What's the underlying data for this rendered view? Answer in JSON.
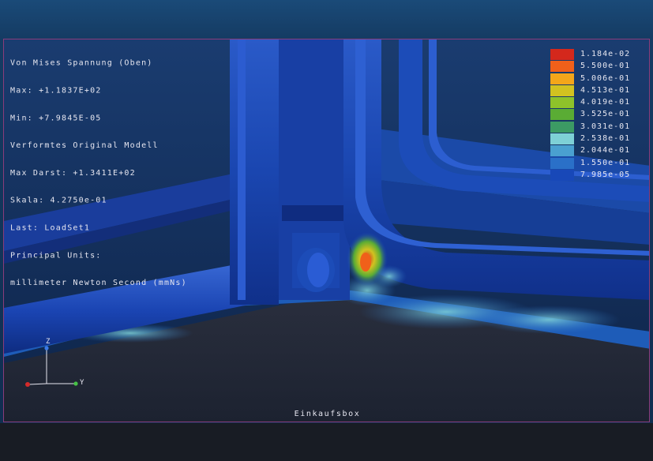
{
  "info_lines": [
    "Von Mises Spannung (Oben)",
    "Max: +1.1837E+02",
    "Min: +7.9845E-05",
    "Verformtes Original Modell",
    "Max Darst: +1.3411E+02",
    "Skala: 4.2750e-01",
    "Last: LoadSet1",
    "Principal Units:",
    "millimeter Newton Second (mmNs)"
  ],
  "legend": {
    "labels": [
      "1.184e-02",
      "5.500e-01",
      "5.006e-01",
      "4.513e-01",
      "4.019e-01",
      "3.525e-01",
      "3.031e-01",
      "2.538e-01",
      "2.044e-01",
      "1.550e-01",
      "7.985e-05"
    ],
    "colors": [
      "#d4281c",
      "#f0601a",
      "#f4a61a",
      "#d2c220",
      "#8ec22a",
      "#5aac34",
      "#3c9a64",
      "#7ed0d6",
      "#4aa0d0",
      "#2a70c8",
      "#1848b8"
    ]
  },
  "triad": {
    "z_label": "Z",
    "y_label": "Y"
  },
  "model_name": "Einkaufsbox"
}
